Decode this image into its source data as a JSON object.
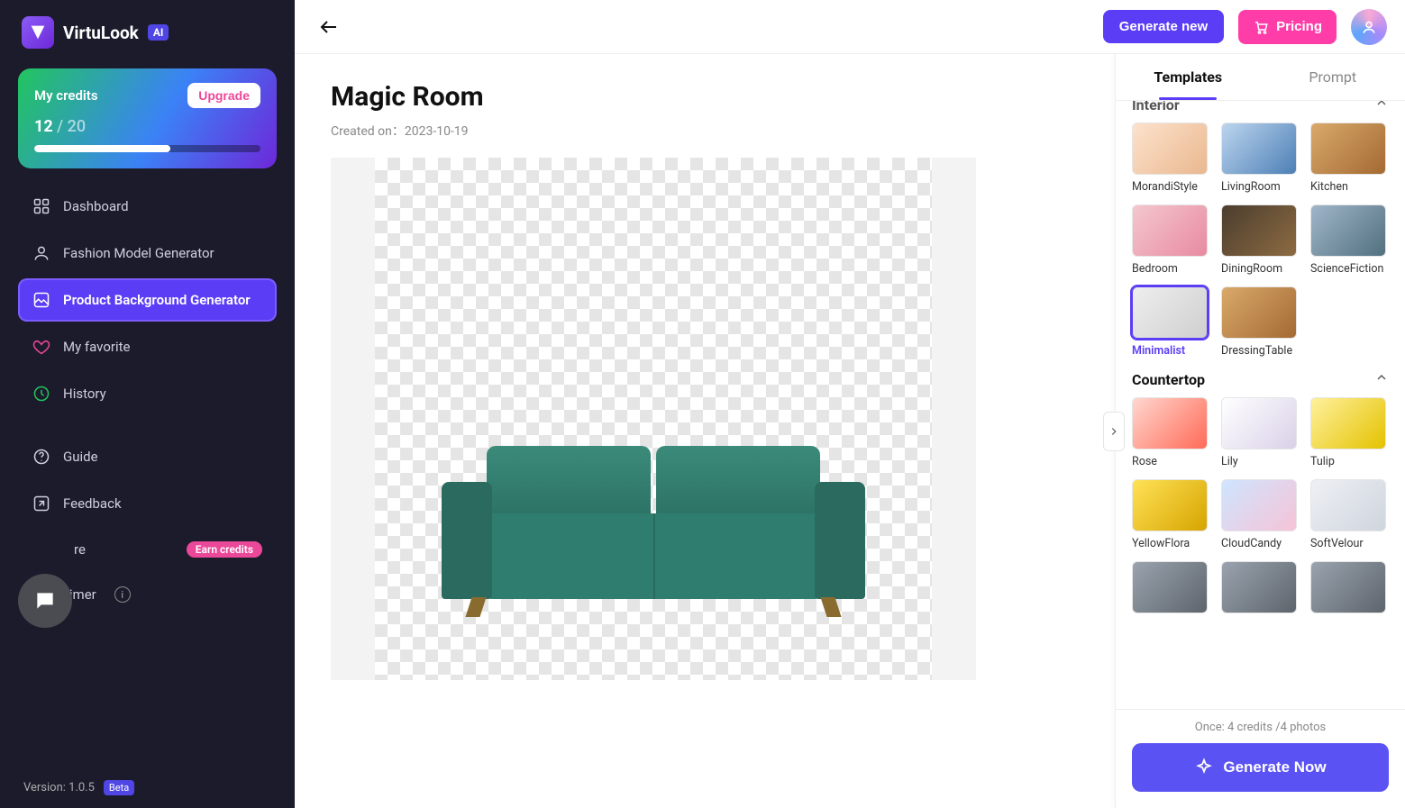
{
  "brand": {
    "name": "VirtuLook",
    "ai_badge": "AI"
  },
  "credits": {
    "title": "My credits",
    "upgrade": "Upgrade",
    "used": "12",
    "sep": " / ",
    "total": "20",
    "fill_pct": 60
  },
  "nav": {
    "dashboard": "Dashboard",
    "fashion": "Fashion Model Generator",
    "product_bg": "Product Background Generator",
    "favorite": "My favorite",
    "history": "History",
    "guide": "Guide",
    "feedback": "Feedback",
    "share": "re",
    "earn_credits": "Earn credits",
    "disclaimer": "Disclaimer"
  },
  "version": {
    "label": "Version: 1.0.5",
    "beta": "Beta"
  },
  "topbar": {
    "generate_new": "Generate new",
    "pricing": "Pricing"
  },
  "page": {
    "title": "Magic Room",
    "created_prefix": "Created on：",
    "created_date": "2023-10-19"
  },
  "tabs": {
    "templates": "Templates",
    "prompt": "Prompt"
  },
  "sections": {
    "interior": {
      "title": "Interior",
      "items": [
        {
          "label": "MorandiStyle",
          "cls": "th-warm"
        },
        {
          "label": "LivingRoom",
          "cls": "th-blue"
        },
        {
          "label": "Kitchen",
          "cls": "th-wood"
        },
        {
          "label": "Bedroom",
          "cls": "th-pink"
        },
        {
          "label": "DiningRoom",
          "cls": "th-dark"
        },
        {
          "label": "ScienceFiction",
          "cls": "th-sci"
        },
        {
          "label": "Minimalist",
          "cls": "th-min",
          "selected": true
        },
        {
          "label": "DressingTable",
          "cls": "th-wood"
        }
      ]
    },
    "countertop": {
      "title": "Countertop",
      "items": [
        {
          "label": "Rose",
          "cls": "th-rose"
        },
        {
          "label": "Lily",
          "cls": "th-lily"
        },
        {
          "label": "Tulip",
          "cls": "th-tulip"
        },
        {
          "label": "YellowFlora",
          "cls": "th-sun"
        },
        {
          "label": "CloudCandy",
          "cls": "th-cloud"
        },
        {
          "label": "SoftVelour",
          "cls": "th-vel"
        }
      ],
      "extra_row": [
        {
          "label": "",
          "cls": "th-gen"
        },
        {
          "label": "",
          "cls": "th-gen"
        },
        {
          "label": "",
          "cls": "th-gen"
        }
      ]
    }
  },
  "footer": {
    "cost_prefix": "Once: ",
    "cost_credits": "4 credits ",
    "cost_sep": "/",
    "cost_photos": "4 photos",
    "generate_now": "Generate Now"
  }
}
